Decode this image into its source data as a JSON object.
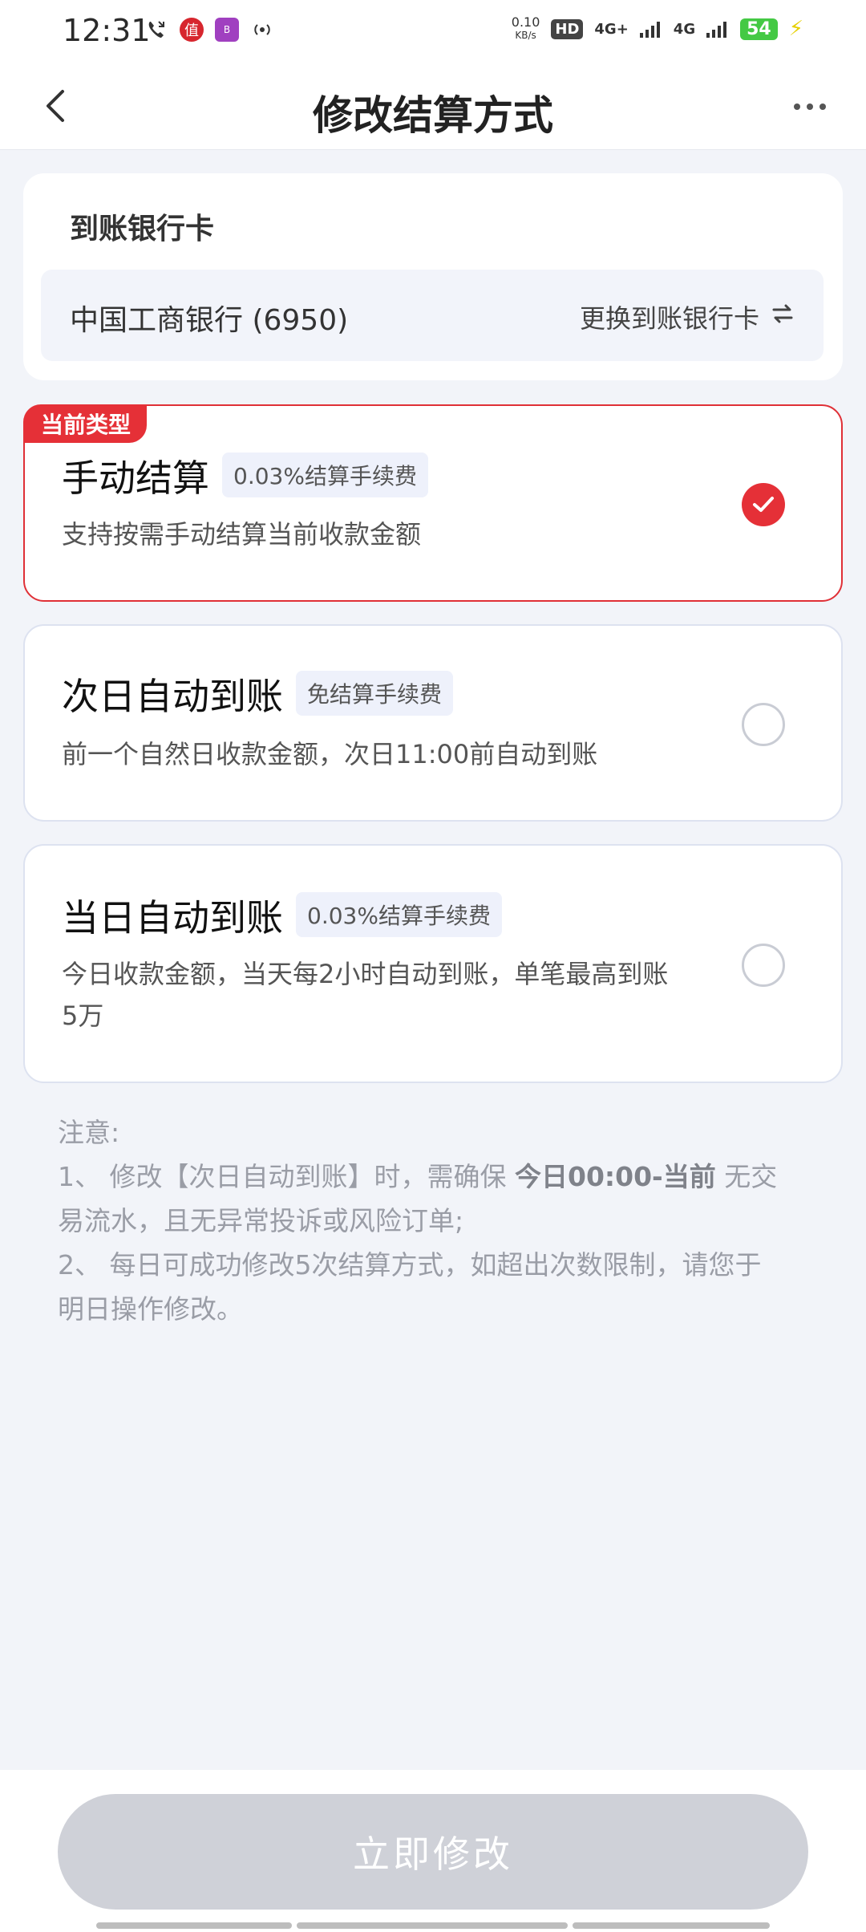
{
  "status_bar": {
    "time": "12:31",
    "speed_value": "0.10",
    "speed_unit": "KB/s",
    "hd_label": "HD",
    "net1": "4G+",
    "net2": "4G",
    "battery": "54"
  },
  "nav": {
    "title": "修改结算方式"
  },
  "bank": {
    "heading": "到账银行卡",
    "card_name": "中国工商银行 (6950)",
    "change_label": "更换到账银行卡"
  },
  "options": [
    {
      "tag": "当前类型",
      "title": "手动结算",
      "fee": "0.03%结算手续费",
      "desc": "支持按需手动结算当前收款金额",
      "selected": true
    },
    {
      "title": "次日自动到账",
      "fee": "免结算手续费",
      "desc": "前一个自然日收款金额，次日11:00前自动到账",
      "selected": false
    },
    {
      "title": "当日自动到账",
      "fee": "0.03%结算手续费",
      "desc_line1": "今日收款金额，当天每2小时自动到账，单笔最高到账",
      "desc_line2": "5万",
      "selected": false
    }
  ],
  "notes": {
    "heading": "注意:",
    "n1_a": "1、 修改【次日自动到账】时，需确保 ",
    "n1_bold": "今日00:00-当前",
    "n1_b": " 无交",
    "n1_line2": "易流水，且无异常投诉或风险订单;",
    "n2_line1": "2、 每日可成功修改5次结算方式，如超出次数限制，请您于",
    "n2_line2": "明日操作修改。"
  },
  "submit_label": "立即修改",
  "colors": {
    "accent": "#e53037",
    "background": "#f2f4f9",
    "button_disabled": "#cfd1d8"
  }
}
